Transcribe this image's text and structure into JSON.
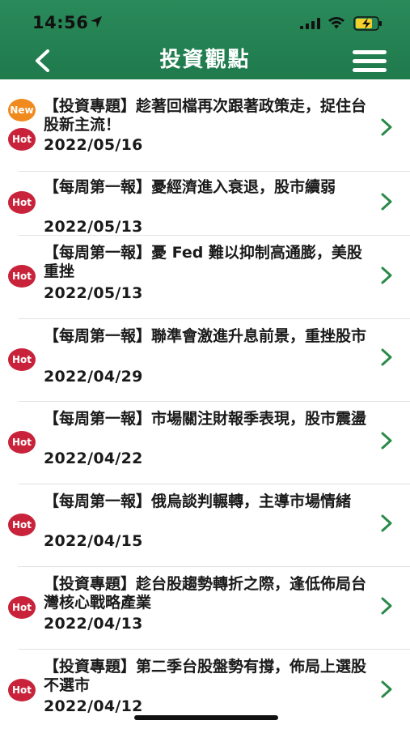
{
  "status_bar": {
    "time": "14:56"
  },
  "header": {
    "title": "投資觀點",
    "background_color": "#1f7a4c"
  },
  "articles": [
    {
      "title": "【投資專題】趁著回檔再次跟著政策走，捉住台股新主流！",
      "date": "2022/05/16",
      "badges": [
        "New",
        "Hot"
      ]
    },
    {
      "title": "【每周第一報】憂經濟進入衰退，股市續弱",
      "date": "2022/05/13",
      "badges": [
        "Hot"
      ]
    },
    {
      "title": "【每周第一報】憂 Fed 難以抑制高通膨，美股重挫",
      "date": "2022/05/13",
      "badges": [
        "Hot"
      ]
    },
    {
      "title": "【每周第一報】聯準會激進升息前景，重挫股市",
      "date": "2022/04/29",
      "badges": [
        "Hot"
      ]
    },
    {
      "title": "【每周第一報】市場關注財報季表現，股市震盪",
      "date": "2022/04/22",
      "badges": [
        "Hot"
      ]
    },
    {
      "title": "【每周第一報】俄烏談判輾轉，主導市場情緒",
      "date": "2022/04/15",
      "badges": [
        "Hot"
      ]
    },
    {
      "title": "【投資專題】趁台股趨勢轉折之際，逢低佈局台灣核心戰略產業",
      "date": "2022/04/13",
      "badges": [
        "Hot"
      ]
    },
    {
      "title": "【投資專題】第二季台股盤勢有撐，佈局上選股不選市",
      "date": "2022/04/12",
      "badges": [
        "Hot"
      ]
    }
  ],
  "colors": {
    "hot_badge": "#c8233a",
    "new_badge": "#f08a1e",
    "chevron": "#2a8a4a"
  }
}
